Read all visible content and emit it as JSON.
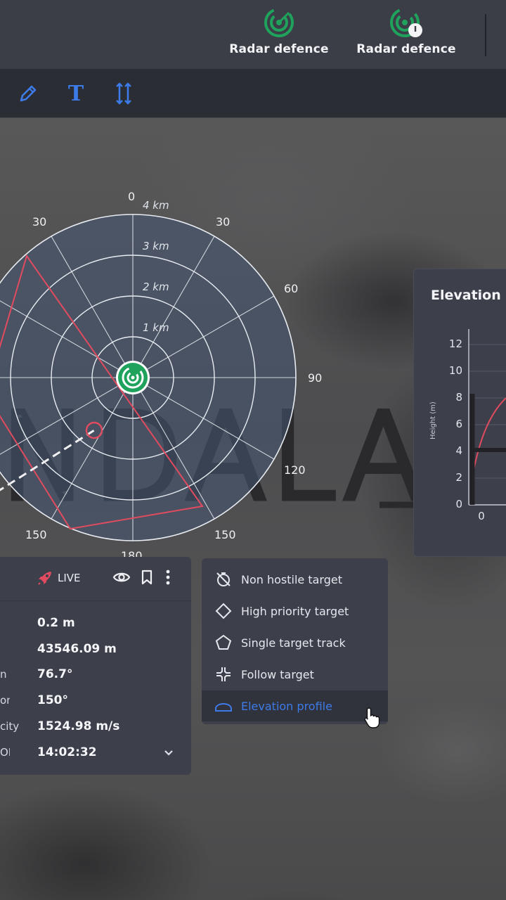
{
  "header": {
    "buttons": [
      {
        "label": "Radar defence",
        "icon": "radar-icon"
      },
      {
        "label": "Radar defence",
        "icon": "radar-alert-icon"
      }
    ]
  },
  "toolbar": {
    "tools": [
      "pencil-icon",
      "text-tool-icon",
      "vertical-resize-icon"
    ],
    "text_tool_glyph": "T"
  },
  "map": {
    "label_text": "NDALA",
    "radar": {
      "bearings": [
        "0",
        "30",
        "30",
        "60",
        "90",
        "120",
        "150",
        "150",
        "180"
      ],
      "ranges": [
        "4 km",
        "3 km",
        "2 km",
        "1 km"
      ],
      "accent": "#1fa35c"
    }
  },
  "elevation_panel": {
    "title": "Elevation",
    "y_ticks": [
      "12",
      "10",
      "8",
      "6",
      "4",
      "2",
      "0"
    ],
    "x_ticks": [
      "0"
    ],
    "y_axis_label": "Height (m)"
  },
  "target_info": {
    "status_label": "LIVE",
    "rows": [
      {
        "label": "",
        "value": "0.2 m"
      },
      {
        "label": "",
        "value": "43546.09 m"
      },
      {
        "label": "n",
        "value": "76.7°"
      },
      {
        "label": "on",
        "value": "150°"
      },
      {
        "label": "city",
        "value": "1524.98 m/s"
      },
      {
        "label": "OI",
        "value": "14:02:32"
      }
    ]
  },
  "context_menu": {
    "items": [
      {
        "label": "Non hostile target",
        "icon": "non-hostile-icon"
      },
      {
        "label": "High priority target",
        "icon": "diamond-icon"
      },
      {
        "label": "Single target track",
        "icon": "pentagon-icon"
      },
      {
        "label": "Follow target",
        "icon": "crosshair-icon"
      },
      {
        "label": "Elevation profile",
        "icon": "elevation-icon",
        "active": true
      }
    ]
  },
  "colors": {
    "accent_blue": "#3d7be8",
    "radar_green": "#1fa35c",
    "alert_red": "#e04b5f"
  }
}
